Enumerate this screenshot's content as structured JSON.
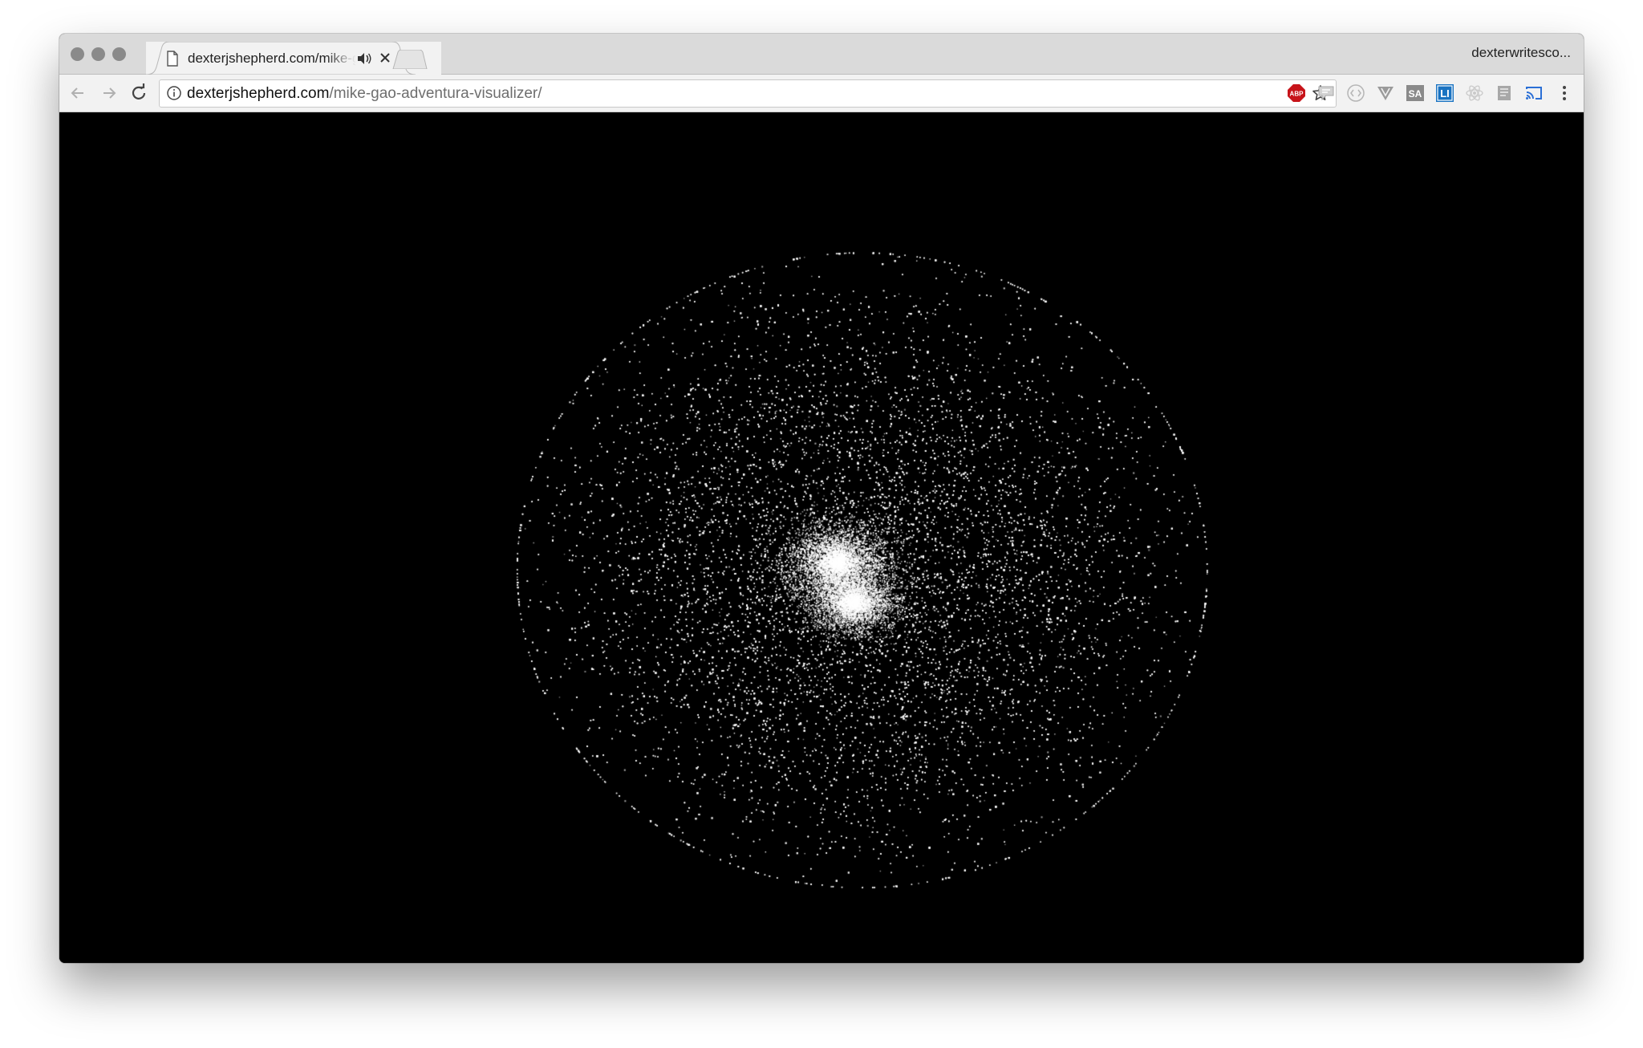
{
  "browser": {
    "tab": {
      "title": "dexterjshepherd.com/mike-gao-adventura-visualizer/",
      "favicon": "page-icon",
      "audio_icon": "speaker-icon",
      "close_icon": "close-icon"
    },
    "profile_name": "dexterwritesco...",
    "toolbar": {
      "back_icon": "back-arrow-icon",
      "forward_icon": "forward-arrow-icon",
      "reload_icon": "reload-icon",
      "url_host": "dexterjshepherd.com",
      "url_path": "/mike-gao-adventura-visualizer/",
      "star_icon": "star-icon",
      "menu_icon": "kebab-menu-icon"
    },
    "extensions": [
      {
        "name": "adblock-plus-icon",
        "label": "ABP",
        "color": "#c7141a"
      },
      {
        "name": "speech-bubble-icon",
        "label": "",
        "color": "#b5b5b5"
      },
      {
        "name": "code-brackets-icon",
        "label": "",
        "color": "#b5b5b5"
      },
      {
        "name": "v-shield-icon",
        "label": "",
        "color": "#9a9a9a"
      },
      {
        "name": "sa-icon",
        "label": "SA",
        "color": "#8a8a8a"
      },
      {
        "name": "li-icon",
        "label": "LI",
        "color": "#1a73c2"
      },
      {
        "name": "react-atom-icon",
        "label": "",
        "color": "#c9c9c9"
      },
      {
        "name": "document-icon",
        "label": "",
        "color": "#9c9c9c"
      },
      {
        "name": "cast-icon",
        "label": "",
        "color": "#2a6fd6"
      }
    ]
  },
  "visualizer": {
    "background": "#000000",
    "particle_color": "#ffffff",
    "element": "particle-cloud"
  }
}
